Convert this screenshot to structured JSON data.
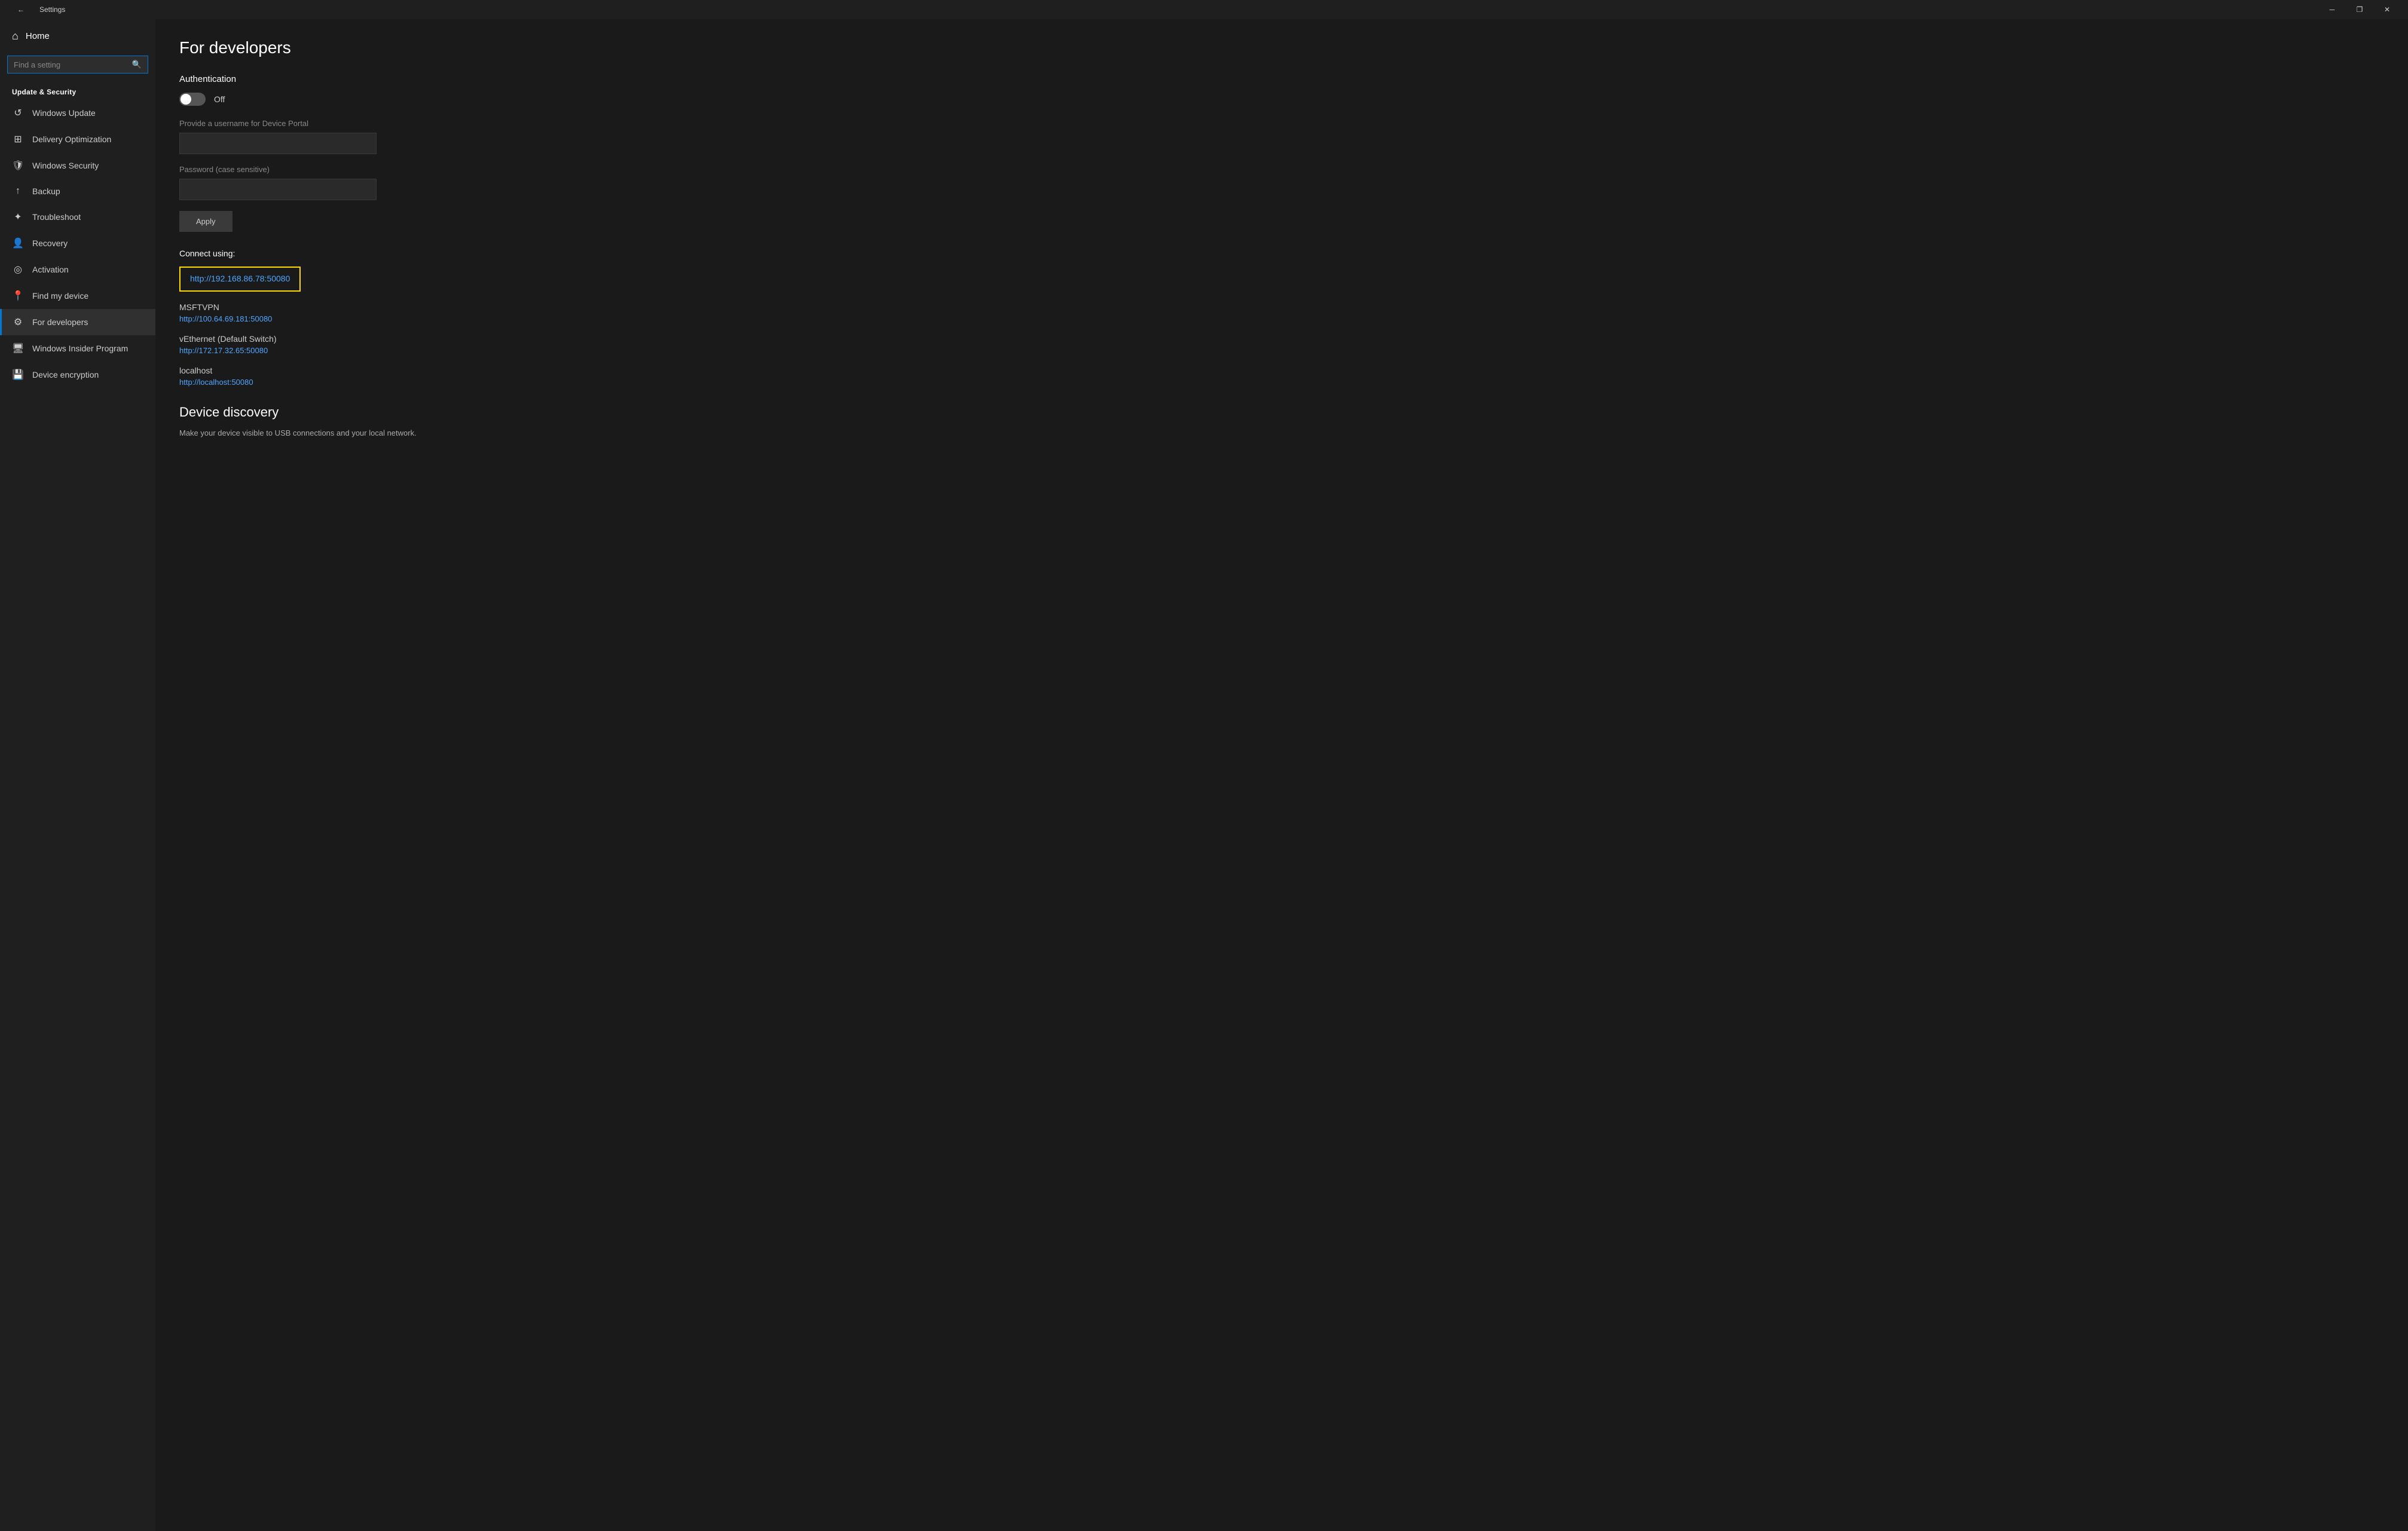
{
  "titleBar": {
    "title": "Settings",
    "backIcon": "←",
    "minIcon": "─",
    "restoreIcon": "❐",
    "closeIcon": "✕"
  },
  "sidebar": {
    "homeLabel": "Home",
    "searchPlaceholder": "Find a setting",
    "sectionLabel": "Update & Security",
    "items": [
      {
        "id": "windows-update",
        "label": "Windows Update",
        "icon": "↺"
      },
      {
        "id": "delivery-optimization",
        "label": "Delivery Optimization",
        "icon": "⇣"
      },
      {
        "id": "windows-security",
        "label": "Windows Security",
        "icon": "🛡"
      },
      {
        "id": "backup",
        "label": "Backup",
        "icon": "↑"
      },
      {
        "id": "troubleshoot",
        "label": "Troubleshoot",
        "icon": "⚙"
      },
      {
        "id": "recovery",
        "label": "Recovery",
        "icon": "👤"
      },
      {
        "id": "activation",
        "label": "Activation",
        "icon": "✓"
      },
      {
        "id": "find-my-device",
        "label": "Find my device",
        "icon": "📍"
      },
      {
        "id": "for-developers",
        "label": "For developers",
        "icon": "⚙",
        "active": true
      },
      {
        "id": "windows-insider",
        "label": "Windows Insider Program",
        "icon": "🖥"
      },
      {
        "id": "device-encryption",
        "label": "Device encryption",
        "icon": "💾"
      }
    ]
  },
  "main": {
    "pageTitle": "For developers",
    "authSection": {
      "title": "Authentication",
      "toggleState": "off",
      "toggleLabel": "Off"
    },
    "usernameField": {
      "label": "Provide a username for Device Portal",
      "placeholder": ""
    },
    "passwordField": {
      "label": "Password (case sensitive)",
      "placeholder": ""
    },
    "applyButton": "Apply",
    "connectSection": {
      "label": "Connect using:",
      "primaryLink": "http://192.168.86.78:50080",
      "networks": [
        {
          "name": "MSFTVPN",
          "link": "http://100.64.69.181:50080"
        },
        {
          "name": "vEthernet (Default Switch)",
          "link": "http://172.17.32.65:50080"
        },
        {
          "name": "localhost",
          "link": "http://localhost:50080"
        }
      ]
    },
    "deviceDiscovery": {
      "title": "Device discovery",
      "description": "Make your device visible to USB connections and your local network."
    }
  }
}
